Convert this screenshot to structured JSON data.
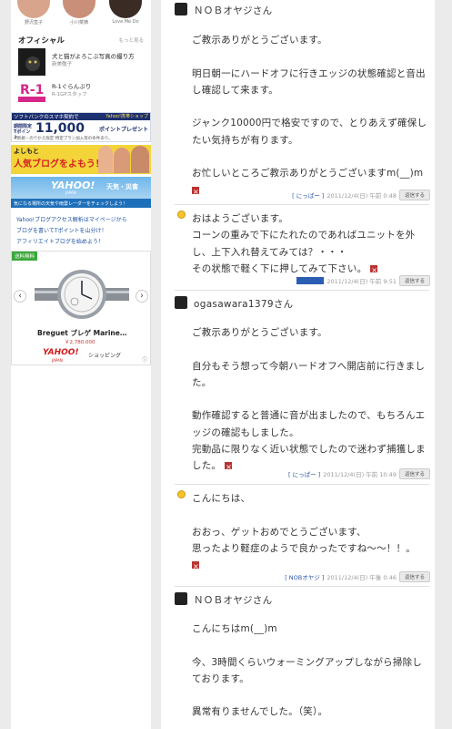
{
  "sidebar": {
    "faces": [
      {
        "caption": "野沢直子"
      },
      {
        "caption": "小川菜摘"
      },
      {
        "caption": "Love Me Do"
      }
    ],
    "official": {
      "title": "オフィシャル",
      "more": "もっと見る",
      "items": [
        {
          "title": "犬と猫がよろこぶ写真の撮り方",
          "sub": "新美敬子"
        },
        {
          "title": "R-1ぐらんぷり",
          "sub": "R-1GPスタッフ"
        }
      ]
    },
    "banners": {
      "softbank": {
        "line1": "ソフトバンクのスマホ契約で",
        "shop": "Yahoo!携帯ショップ",
        "prefix": "期間限定 Tポイント",
        "points": "11,000",
        "suffix": "ポイントプレゼント",
        "note": "※新規・のりかえ限定 特定プラン加入等の条件あり。"
      },
      "yoshimoto": {
        "line1": "よしもと",
        "line2": "人気ブログをよもう！"
      },
      "weather": {
        "brand": "YAHOO!",
        "title": "天気・災害",
        "japan": "JAPAN",
        "caption": "気になる場所の天気や雨雲レーダーをチェックしよう！"
      }
    },
    "promo_links": [
      "Yahoo!ブログアクセス解析はマイページから",
      "ブログを書いてTポイントを山分け！",
      "アフィリエイトブログを始めよう！"
    ],
    "ad": {
      "badge": "送料無料",
      "product": "Breguet ブレゲ Marine…",
      "price": "￥2,780,000",
      "shop_brand": "YAHOO!",
      "shop_japan": "JAPAN",
      "shop_name": "ショッピング",
      "prev": "‹",
      "next": "›",
      "info": "ⓘ"
    }
  },
  "comments": [
    {
      "name": "ＮＯＢオヤジさん",
      "lines": [
        "ご教示ありがとうございます。",
        "",
        "明日朝一にハードオフに行きエッジの状態確認と音出し確認して来ます。",
        "",
        "ジャンク10000円で格安ですので、とりあえず確保したい気持ちが有ります。",
        "",
        "お忙しいところご教示ありがとうございますm(__)m"
      ],
      "author": "[ にっぱー ]",
      "date": "2011/12/4(日) 午前 0:48",
      "reply": "返信する"
    },
    {
      "name": "",
      "lines": [
        "おはようございます。",
        "コーンの重みで下にたれたのであればユニットを外し、上下入れ替えてみては？・・・",
        "その状態で軽く下に押してみて下さい。"
      ],
      "author": "",
      "date": "2011/12/4(日) 午前 9:51",
      "reply": "返信する"
    },
    {
      "name": "ogasawara1379さん",
      "lines": [
        "ご教示ありがとうございます。",
        "",
        "自分もそう想って今朝ハードオフへ開店前に行きました。",
        "",
        "動作確認すると普通に音が出ましたので、もちろんエッジの確認もしました。",
        "完動品に限りなく近い状態でしたので迷わず捕獲しました。"
      ],
      "author": "[ にっぱー ]",
      "date": "2011/12/4(日) 午前 10:49",
      "reply": "返信する"
    },
    {
      "name": "",
      "lines": [
        "こんにちは、",
        "",
        "おおっ、ゲットおめでとうございます、",
        "思ったより軽症のようで良かったですね〜〜！！。"
      ],
      "author": "[ NOBオヤジ ]",
      "date": "2011/12/4(日) 午後 0:46",
      "reply": "返信する"
    },
    {
      "name": "ＮＯＢオヤジさん",
      "lines": [
        "こんにちはm(__)m",
        "",
        "今、3時間くらいウォーミングアップしながら掃除しております。",
        "",
        "異常有りませんでした。（笑）。"
      ],
      "author": "",
      "date": "",
      "reply": ""
    }
  ],
  "colors": {
    "link": "#2b57a8",
    "accent_red": "#b33"
  }
}
